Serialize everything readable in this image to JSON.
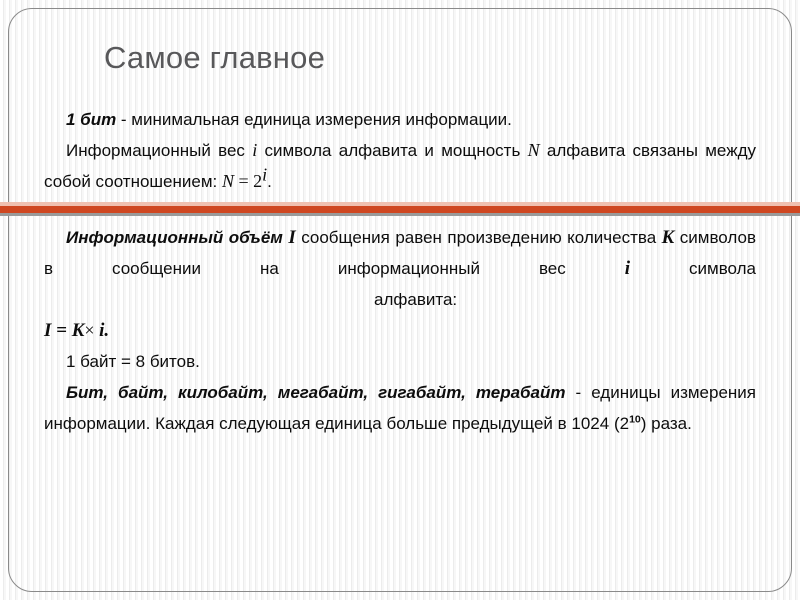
{
  "slide": {
    "title": "Самое главное",
    "accent_color": "#cf4721",
    "frame_color": "#8a8a8a",
    "title_color": "#58585a",
    "text_color": "#0d0d0d"
  },
  "block1": {
    "p1_bold": "1 бит",
    "p1_rest": " - минимальная единица измерения информации.",
    "p2_a": "Информационный вес ",
    "p2_var_i": "i",
    "p2_b": " символа алфавита и мощность ",
    "p2_var_N": "N",
    "p2_c": " алфавита связаны между собой соотношением: ",
    "p2_formula_N": "N",
    "p2_formula_eq": " = 2",
    "p2_formula_sup": "i",
    "p2_formula_end": "."
  },
  "block2": {
    "p1_bold": "Информационный объём",
    "p1_var_I": "I",
    "p1_a": " сообщения равен произведению количества ",
    "p1_var_K": "K",
    "p1_b": " символов в сообщении на информационный вес ",
    "p1_var_i": "i",
    "p1_c": " символа",
    "p1_d": "алфавита:",
    "formula_I": "I",
    "formula_eq": " = ",
    "formula_K": "K",
    "formula_times": "× ",
    "formula_i": "i",
    "formula_end": "."
  },
  "block3": {
    "p1": "1 байт = 8 битов.",
    "p2_bold": "Бит, байт, килобайт, мегабайт, гигабайт, терабайт",
    "p2_a": " - единицы измерения  информации. Каждая следующая единица больше предыдущей в 1024 (2",
    "p2_sup": "10",
    "p2_b": ") раза."
  }
}
